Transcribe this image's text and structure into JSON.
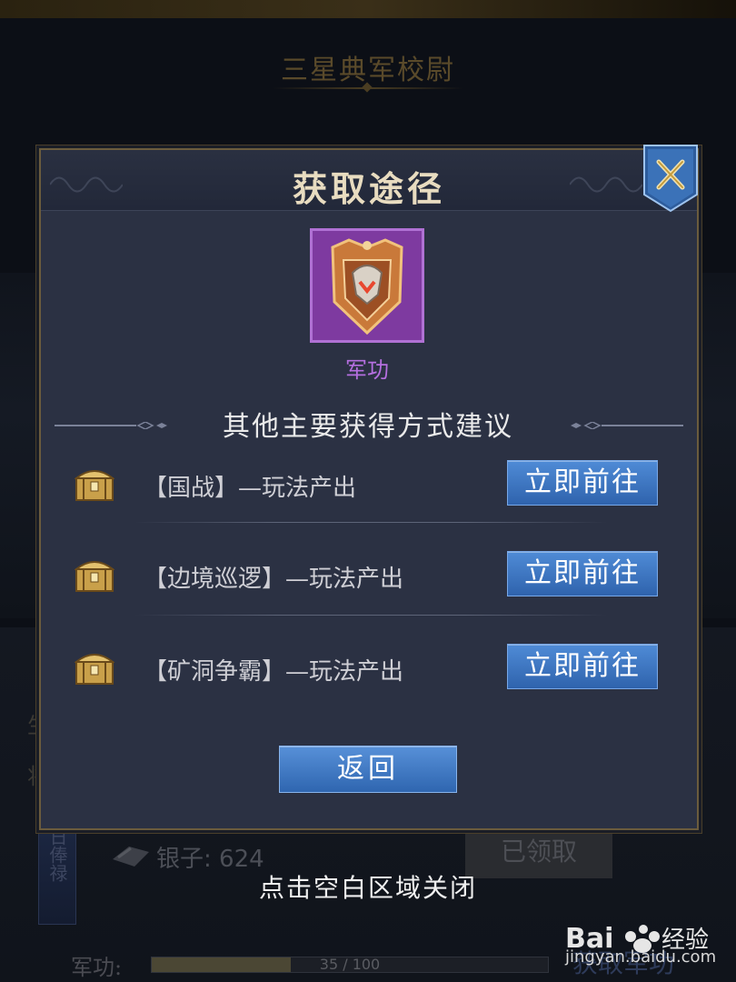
{
  "background": {
    "title": "三星典军校尉",
    "side_banner": "日俸禄",
    "silver_label": "银子: 624",
    "claimed_button": "已领取",
    "military_label": "军功:",
    "progress": {
      "current": 35,
      "max": 100,
      "text": "35 / 100"
    },
    "get_button": "获取军功"
  },
  "modal": {
    "title": "获取途径",
    "item": {
      "name": "军功",
      "icon": "military-merit-badge-icon"
    },
    "section_title": "其他主要获得方式建议",
    "sources": [
      {
        "label": "【国战】—玩法产出",
        "button": "立即前往",
        "icon": "treasure-chest-icon"
      },
      {
        "label": "【边境巡逻】—玩法产出",
        "button": "立即前往",
        "icon": "treasure-chest-icon"
      },
      {
        "label": "【矿洞争霸】—玩法产出",
        "button": "立即前往",
        "icon": "treasure-chest-icon"
      }
    ],
    "back_button": "返回",
    "close_icon": "close-icon"
  },
  "close_hint": "点击空白区域关闭",
  "watermark": {
    "logo": "Bai经验",
    "url": "jingyan.baidu.com"
  },
  "colors": {
    "modal_bg": "#2b3143",
    "gold_border": "#6b5c3d",
    "button_blue": "#3a72c0",
    "item_purple": "#7e3aa0",
    "item_name": "#b56fe0"
  }
}
